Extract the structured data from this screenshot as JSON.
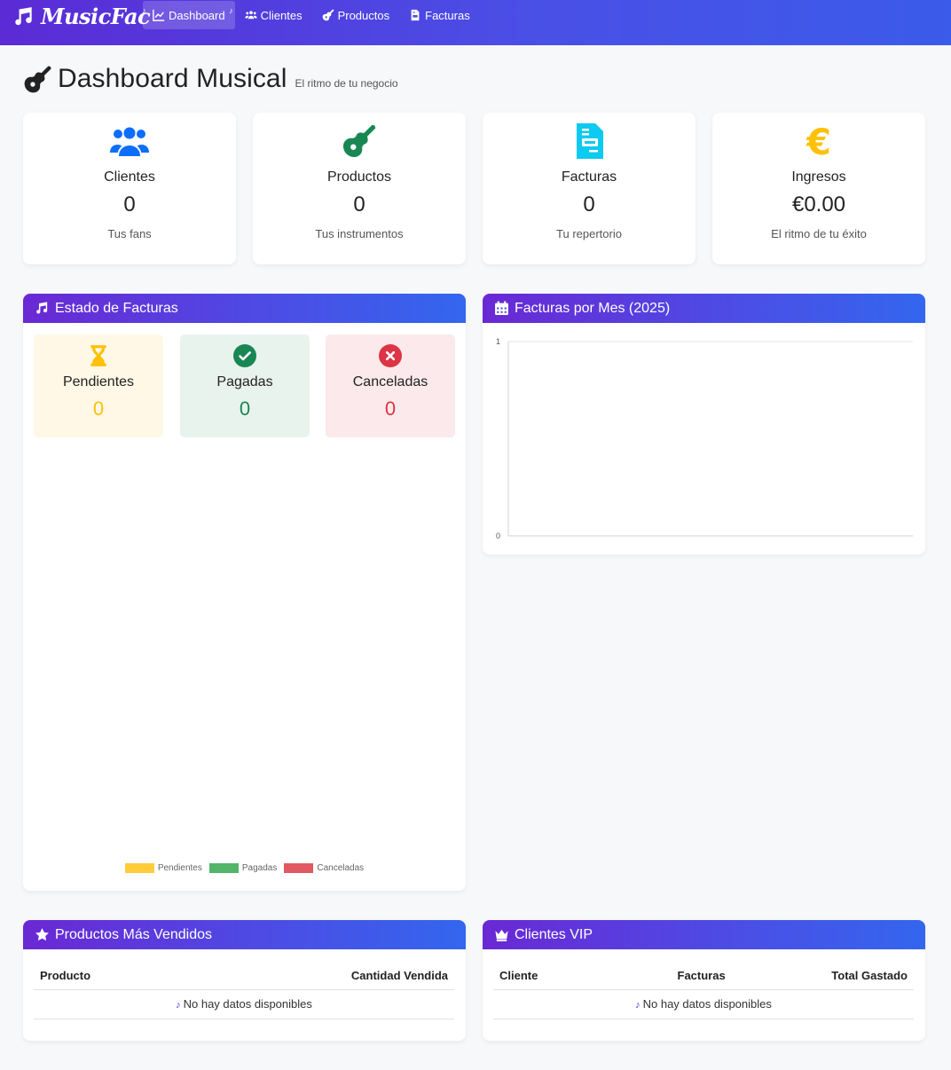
{
  "brand": {
    "name": "MusicFac"
  },
  "nav": {
    "items": [
      {
        "label": "Dashboard",
        "icon": "chart-line-icon",
        "active": true
      },
      {
        "label": "Clientes",
        "icon": "users-icon"
      },
      {
        "label": "Productos",
        "icon": "guitar-icon"
      },
      {
        "label": "Facturas",
        "icon": "file-invoice-icon"
      }
    ],
    "note": "♪"
  },
  "header": {
    "title": "Dashboard Musical",
    "subtitle": "El ritmo de tu negocio"
  },
  "stats": [
    {
      "label": "Clientes",
      "value": "0",
      "desc": "Tus fans",
      "icon": "users-icon",
      "color": "#0d6efd"
    },
    {
      "label": "Productos",
      "value": "0",
      "desc": "Tus instrumentos",
      "icon": "guitar-icon",
      "color": "#198754"
    },
    {
      "label": "Facturas",
      "value": "0",
      "desc": "Tu repertorio",
      "icon": "file-invoice-icon",
      "color": "#0dcaf0"
    },
    {
      "label": "Ingresos",
      "value": "€0.00",
      "desc": "El ritmo de tu éxito",
      "icon": "euro-icon",
      "color": "#ffc107"
    }
  ],
  "estado": {
    "title": "Estado de Facturas",
    "icon": "music-icon",
    "boxes": [
      {
        "label": "Pendientes",
        "value": "0",
        "color": "#ffc107",
        "bg": "#fff8e6",
        "icon": "hourglass-icon"
      },
      {
        "label": "Pagadas",
        "value": "0",
        "color": "#198754",
        "bg": "#e8f3ed",
        "icon": "check-circle-icon"
      },
      {
        "label": "Canceladas",
        "value": "0",
        "color": "#dc3545",
        "bg": "#fbe9eb",
        "icon": "x-circle-icon"
      }
    ],
    "legend": [
      {
        "label": "Pendientes",
        "color": "#ffcd39"
      },
      {
        "label": "Pagadas",
        "color": "#52b56a"
      },
      {
        "label": "Canceladas",
        "color": "#e05862"
      }
    ]
  },
  "facturas_mes": {
    "title": "Facturas por Mes (2025)",
    "icon": "calendar-icon"
  },
  "chart_data": {
    "type": "bar",
    "title": "",
    "categories": [],
    "values": [],
    "ylim": [
      0,
      1
    ],
    "yticks": [
      "0",
      "1"
    ],
    "grid": true
  },
  "productos_vendidos": {
    "title": "Productos Más Vendidos",
    "icon": "star-icon",
    "columns": [
      "Producto",
      "Cantidad Vendida"
    ],
    "empty": "No hay datos disponibles"
  },
  "clientes_vip": {
    "title": "Clientes VIP",
    "icon": "crown-icon",
    "columns": [
      "Cliente",
      "Facturas",
      "Total Gastado"
    ],
    "empty": "No hay datos disponibles"
  }
}
